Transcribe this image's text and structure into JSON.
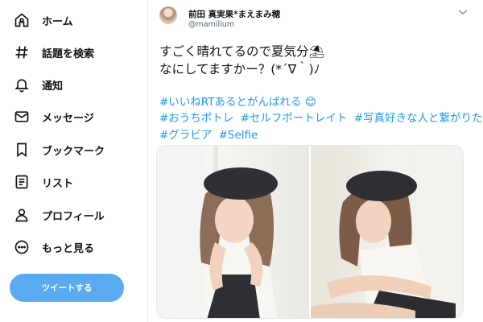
{
  "sidebar": {
    "items": [
      {
        "label": "ホーム",
        "icon": "home-icon"
      },
      {
        "label": "話題を検索",
        "icon": "hashtag-icon"
      },
      {
        "label": "通知",
        "icon": "bell-icon"
      },
      {
        "label": "メッセージ",
        "icon": "mail-icon"
      },
      {
        "label": "ブックマーク",
        "icon": "bookmark-icon"
      },
      {
        "label": "リスト",
        "icon": "list-icon"
      },
      {
        "label": "プロフィール",
        "icon": "person-icon"
      },
      {
        "label": "もっと見る",
        "icon": "more-icon"
      }
    ],
    "tweet_button": "ツイートする"
  },
  "tweet": {
    "display_name": "前田 真実果*まえまみ穂",
    "handle": "@mamilium",
    "text_lines": [
      "すごく晴れてるので夏気分⛱",
      "なにしてますかー？(*´∇｀)ﾉ"
    ],
    "hashtag_lines": [
      [
        "#いいねRTあるとがんばれる 😊"
      ],
      [
        "#おうちポトレ",
        "#セルフポートレイト",
        "#写真好きな人と繋がりたい"
      ],
      [
        "#グラビア",
        "#Selfie"
      ]
    ]
  },
  "colors": {
    "accent": "#1d9bf0",
    "button": "#5aaaf0",
    "text": "#0f1419",
    "muted": "#536471"
  }
}
